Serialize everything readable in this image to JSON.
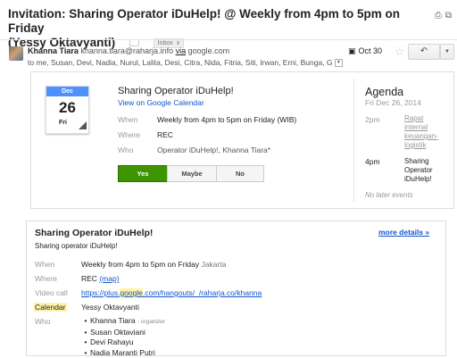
{
  "subject": {
    "line1": "Invitation: Sharing Operator iDuHelp! @ Weekly from 4pm to 5pm on Friday",
    "line2": "(Yessy Oktavyanti)",
    "inbox_label": "Inbox",
    "label_close": "x"
  },
  "sender": {
    "name": "Khanna Tiara",
    "email": "khanna.tiara@raharja.info",
    "via": "via",
    "domain": "google.com",
    "to_line": "to me, Susan, Devi, Nadia, Nurul, Lalita, Desi, Citra, Nida, Fitria, Siti, Irwan, Erni, Bunga, G",
    "date": "Oct 30"
  },
  "invite": {
    "month": "Dec",
    "day": "26",
    "dow": "Fri",
    "title": "Sharing Operator iDuHelp!",
    "view_link": "View on Google Calendar",
    "labels": {
      "when": "When",
      "where": "Where",
      "who": "Who"
    },
    "when": "Weekly from 4pm to 5pm on Friday (WIB)",
    "where": "REC",
    "who": "Operator iDuHelp!, Khanna Tiara*",
    "rsvp": {
      "yes": "Yes",
      "maybe": "Maybe",
      "no": "No"
    }
  },
  "agenda": {
    "title": "Agenda",
    "date": "Fri Dec 26, 2014",
    "items": [
      {
        "time": "2pm",
        "lines": [
          "Rapat",
          "internal",
          "keuangan-",
          "logistik"
        ]
      },
      {
        "time": "4pm",
        "lines": [
          "Sharing",
          "Operator",
          "iDuHelp!"
        ]
      }
    ],
    "no_more": "No later events"
  },
  "details": {
    "title": "Sharing Operator iDuHelp!",
    "more_details": "more details »",
    "subtitle": "Sharing operator iDuHelp!",
    "labels": {
      "when": "When",
      "where": "Where",
      "video": "Video call",
      "calendar": "Calendar",
      "who": "Who"
    },
    "when": "Weekly from 4pm to 5pm on Friday",
    "when_place": "Jakarta",
    "where": "REC",
    "map": "(map)",
    "video_pre": "https://plus.",
    "video_hl": "google",
    "video_post": ".com/hangouts/_/raharja.co/khanna",
    "calendar": "Yessy Oktavyanti",
    "who": [
      {
        "name": "Khanna Tiara",
        "note": "- organizer"
      },
      {
        "name": "Susan Oktaviani",
        "note": ""
      },
      {
        "name": "Devi Rahayu",
        "note": ""
      },
      {
        "name": "Nadia Maranti Putri",
        "note": ""
      }
    ]
  },
  "colors": {
    "link": "#1155cc",
    "yes_button": "#3d9400",
    "calendar_header": "#4d90fe",
    "highlight": "#fff3a8"
  },
  "icons": [
    "print-icon",
    "new-window-icon",
    "tag-icon",
    "calendar-icon",
    "star-icon",
    "reply-icon",
    "more-options-icon",
    "expand-recipients-icon"
  ]
}
